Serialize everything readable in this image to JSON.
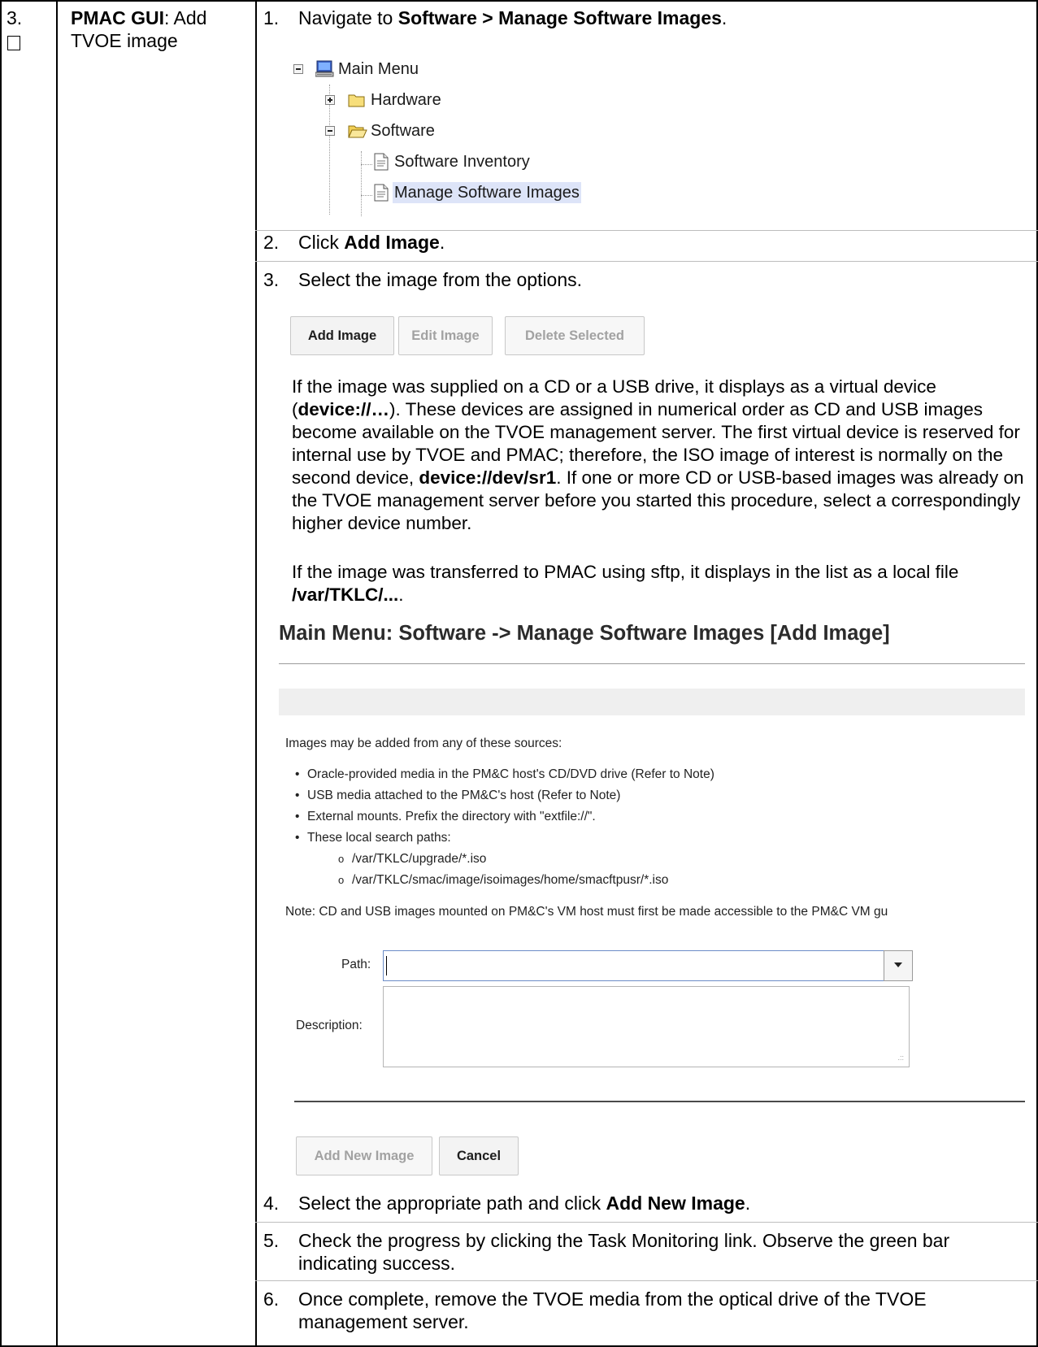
{
  "step": {
    "number": "3.",
    "title_bold": "PMAC GUI",
    "title_rest": ": Add TVOE image"
  },
  "items": {
    "i1": {
      "num": "1.",
      "pre": "Navigate to ",
      "bold": "Software > Manage Software Images",
      "post": "."
    },
    "i2": {
      "num": "2.",
      "pre": "Click ",
      "bold": "Add Image",
      "post": "."
    },
    "i3": {
      "num": "3.",
      "text": "Select the image from the options."
    },
    "i4": {
      "num": "4.",
      "pre": "Select the appropriate path and click ",
      "bold": "Add New Image",
      "post": "."
    },
    "i5": {
      "num": "5.",
      "text": "Check the progress by clicking the Task Monitoring link.  Observe the green bar indicating success."
    },
    "i6": {
      "num": "6.",
      "text": "Once complete, remove the TVOE media from the optical drive of the TVOE management server."
    }
  },
  "tree": {
    "main_menu": "Main Menu",
    "hardware": "Hardware",
    "software": "Software",
    "software_inventory": "Software Inventory",
    "manage_software_images": "Manage Software Images"
  },
  "buttons": {
    "add_image": "Add Image",
    "edit_image": "Edit Image",
    "delete_selected": "Delete Selected"
  },
  "para1": {
    "a": "If the image was supplied on a CD or a USB drive, it displays as a virtual device (",
    "b": "device://…",
    "c": ").  These devices are assigned in numerical order as CD and USB images become available on the TVOE management server.  The first virtual device is reserved for internal use by TVOE and PMAC; therefore, the ISO image of interest is normally on the second device, ",
    "d": "device://dev/sr1",
    "e": ".  If one or more CD or USB-based images was already on the TVOE management server before you started this procedure, select a correspondingly higher device number."
  },
  "para2": {
    "a": "If the image was transferred to PMAC using sftp, it displays in the list as a local file ",
    "b": "/var/TKLC/...",
    "c": "."
  },
  "form": {
    "title": "Main Menu: Software -> Manage Software Images [Add Image]",
    "intro": "Images may be added from any of these sources:",
    "bullets": [
      "Oracle-provided media in the PM&C host's CD/DVD drive (Refer to Note)",
      "USB media attached to the PM&C's host (Refer to Note)",
      "External mounts. Prefix the directory with \"extfile://\".",
      "These local search paths:"
    ],
    "paths": [
      "/var/TKLC/upgrade/*.iso",
      "/var/TKLC/smac/image/isoimages/home/smacftpusr/*.iso"
    ],
    "note": "Note: CD and USB images mounted on PM&C's VM host must first be made accessible to the PM&C VM gu",
    "path_label": "Path:",
    "path_value": "",
    "description_label": "Description:",
    "description_value": "",
    "add_new_image": "Add New Image",
    "cancel": "Cancel"
  }
}
